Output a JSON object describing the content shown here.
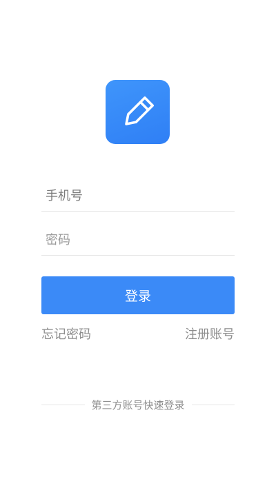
{
  "logo": {
    "icon": "pencil-icon",
    "color": "#3b8af7"
  },
  "form": {
    "phone_placeholder": "手机号",
    "phone_value": "",
    "password_placeholder": "密码",
    "password_value": "",
    "login_label": "登录"
  },
  "links": {
    "forgot_password": "忘记密码",
    "register": "注册账号"
  },
  "third_party": {
    "label": "第三方账号快速登录"
  },
  "colors": {
    "accent": "#3b8af7",
    "muted_text": "#8e8e8e",
    "divider": "#e6e6e6"
  }
}
